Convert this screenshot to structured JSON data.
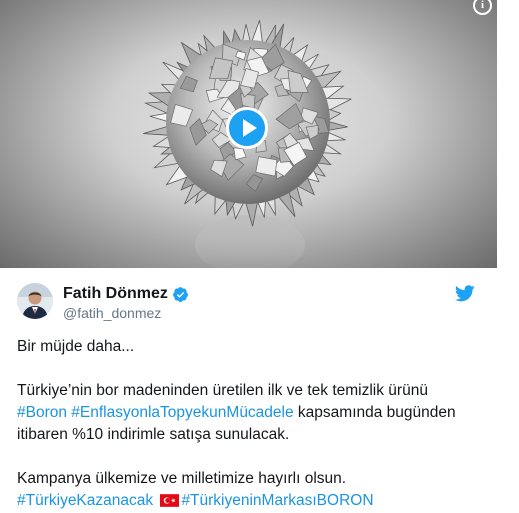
{
  "tweet": {
    "author_name": "Fatih Dönmez",
    "author_handle": "@fatih_donmez",
    "lines": {
      "l1": "Bir müjde daha...",
      "l2": "Türkiye’nin bor madeninden üretilen ilk ve tek temizlik ürünü",
      "l3_tag1": "#Boron",
      "l3_tag2": "#EnflasyonlaTopyekunMücadele",
      "l3_text": " kapsamında bugünden",
      "l4": "itibaren %10 indirimle satışa sunulacak.",
      "l5": "Kampanya ülkemize ve milletimize hayırlı olsun.",
      "l6_tag1": "#TürkiyeKazanacak",
      "l6_tag2": "#TürkiyeninMarkasıBORON"
    }
  },
  "media": {
    "type": "video",
    "info_icon_glyph": "i"
  },
  "icons": {
    "play": "play-icon",
    "info": "info-icon",
    "verified": "verified-badge-icon",
    "twitter": "twitter-bird-icon",
    "flag": "turkey-flag-icon"
  },
  "colors": {
    "link": "#1b95e0",
    "brand": "#1da1f2",
    "text": "#14171a",
    "muted": "#657786"
  }
}
